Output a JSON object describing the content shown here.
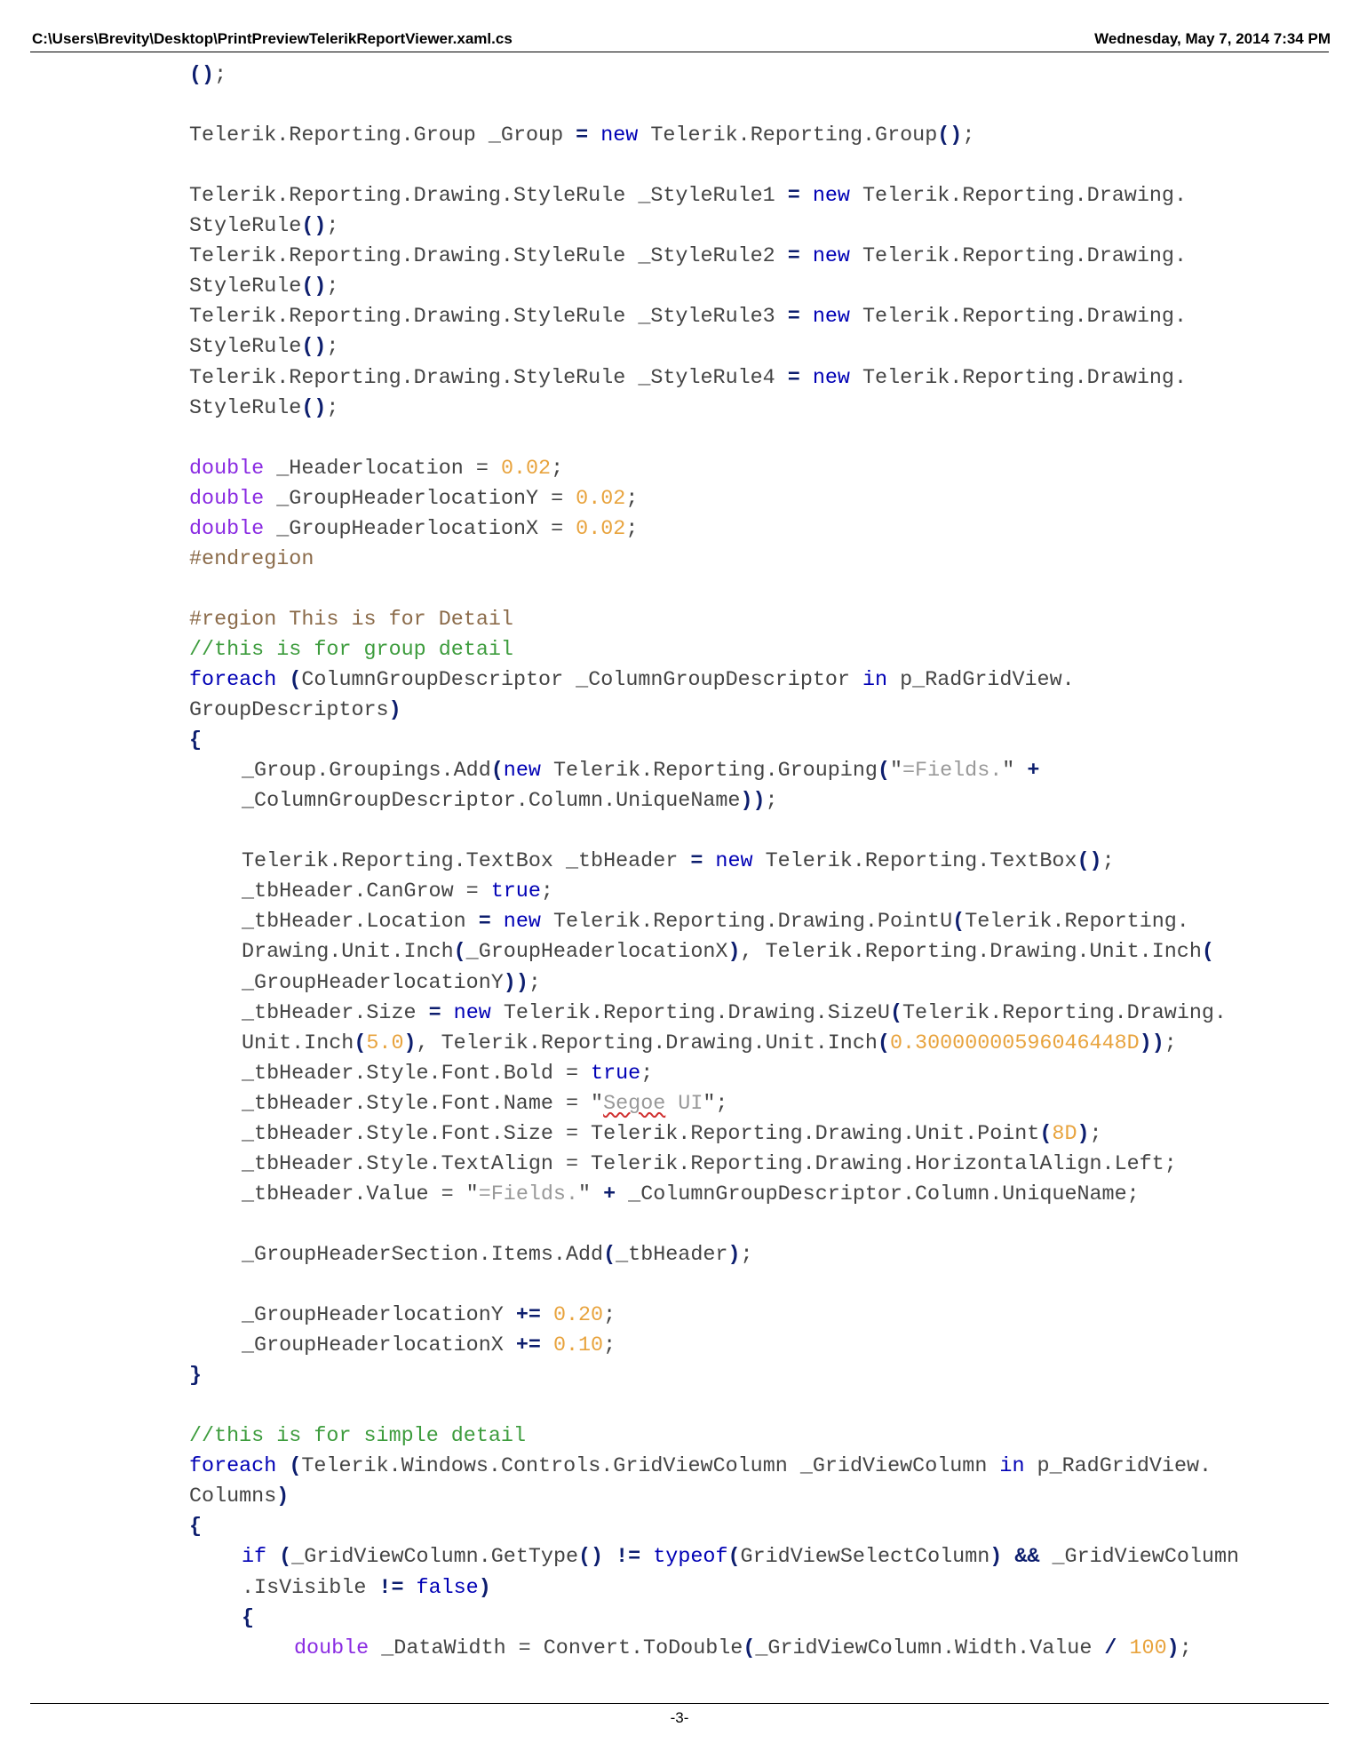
{
  "header": {
    "file_path": "C:\\Users\\Brevity\\Desktop\\PrintPreviewTelerikReportViewer.xaml.cs",
    "date_time": "Wednesday, May 7, 2014 7:34 PM"
  },
  "footer": {
    "page_label": "-3-"
  },
  "code_lines": [
    {
      "indent": 0,
      "tokens": [
        [
          "o",
          "()"
        ],
        [
          "p",
          ";"
        ]
      ]
    },
    null,
    {
      "indent": 0,
      "tokens": [
        [
          "p",
          "Telerik.Reporting.Group _Group "
        ],
        [
          "o",
          "="
        ],
        [
          "p",
          " "
        ],
        [
          "k",
          "new"
        ],
        [
          "p",
          " Telerik.Reporting.Group"
        ],
        [
          "o",
          "()"
        ],
        [
          "p",
          ";"
        ]
      ]
    },
    null,
    {
      "indent": 0,
      "tokens": [
        [
          "p",
          "Telerik.Reporting.Drawing.StyleRule _StyleRule1 "
        ],
        [
          "o",
          "="
        ],
        [
          "p",
          " "
        ],
        [
          "k",
          "new"
        ],
        [
          "p",
          " Telerik.Reporting.Drawing."
        ]
      ]
    },
    {
      "indent": 0,
      "tokens": [
        [
          "p",
          "StyleRule"
        ],
        [
          "o",
          "()"
        ],
        [
          "p",
          ";"
        ]
      ]
    },
    {
      "indent": 0,
      "tokens": [
        [
          "p",
          "Telerik.Reporting.Drawing.StyleRule _StyleRule2 "
        ],
        [
          "o",
          "="
        ],
        [
          "p",
          " "
        ],
        [
          "k",
          "new"
        ],
        [
          "p",
          " Telerik.Reporting.Drawing."
        ]
      ]
    },
    {
      "indent": 0,
      "tokens": [
        [
          "p",
          "StyleRule"
        ],
        [
          "o",
          "()"
        ],
        [
          "p",
          ";"
        ]
      ]
    },
    {
      "indent": 0,
      "tokens": [
        [
          "p",
          "Telerik.Reporting.Drawing.StyleRule _StyleRule3 "
        ],
        [
          "o",
          "="
        ],
        [
          "p",
          " "
        ],
        [
          "k",
          "new"
        ],
        [
          "p",
          " Telerik.Reporting.Drawing."
        ]
      ]
    },
    {
      "indent": 0,
      "tokens": [
        [
          "p",
          "StyleRule"
        ],
        [
          "o",
          "()"
        ],
        [
          "p",
          ";"
        ]
      ]
    },
    {
      "indent": 0,
      "tokens": [
        [
          "p",
          "Telerik.Reporting.Drawing.StyleRule _StyleRule4 "
        ],
        [
          "o",
          "="
        ],
        [
          "p",
          " "
        ],
        [
          "k",
          "new"
        ],
        [
          "p",
          " Telerik.Reporting.Drawing."
        ]
      ]
    },
    {
      "indent": 0,
      "tokens": [
        [
          "p",
          "StyleRule"
        ],
        [
          "o",
          "()"
        ],
        [
          "p",
          ";"
        ]
      ]
    },
    null,
    {
      "indent": 0,
      "tokens": [
        [
          "t",
          "double"
        ],
        [
          "p",
          " _Headerlocation = "
        ],
        [
          "n",
          "0.02"
        ],
        [
          "p",
          ";"
        ]
      ]
    },
    {
      "indent": 0,
      "tokens": [
        [
          "t",
          "double"
        ],
        [
          "p",
          " _GroupHeaderlocationY = "
        ],
        [
          "n",
          "0.02"
        ],
        [
          "p",
          ";"
        ]
      ]
    },
    {
      "indent": 0,
      "tokens": [
        [
          "t",
          "double"
        ],
        [
          "p",
          " _GroupHeaderlocationX = "
        ],
        [
          "n",
          "0.02"
        ],
        [
          "p",
          ";"
        ]
      ]
    },
    {
      "indent": 0,
      "tokens": [
        [
          "d",
          "#endregion"
        ]
      ]
    },
    null,
    {
      "indent": 0,
      "tokens": [
        [
          "d",
          "#region This is for Detail"
        ]
      ]
    },
    {
      "indent": 0,
      "tokens": [
        [
          "c",
          "//this is for group detail"
        ]
      ]
    },
    {
      "indent": 0,
      "tokens": [
        [
          "k",
          "foreach"
        ],
        [
          "p",
          " "
        ],
        [
          "o",
          "("
        ],
        [
          "p",
          "ColumnGroupDescriptor _ColumnGroupDescriptor "
        ],
        [
          "k",
          "in"
        ],
        [
          "p",
          " p_RadGridView."
        ]
      ]
    },
    {
      "indent": 0,
      "tokens": [
        [
          "p",
          "GroupDescriptors"
        ],
        [
          "o",
          ")"
        ]
      ]
    },
    {
      "indent": 0,
      "tokens": [
        [
          "o",
          "{"
        ]
      ]
    },
    {
      "indent": 1,
      "tokens": [
        [
          "p",
          "_Group.Groupings.Add"
        ],
        [
          "o",
          "("
        ],
        [
          "k",
          "new"
        ],
        [
          "p",
          " Telerik.Reporting.Grouping"
        ],
        [
          "o",
          "("
        ],
        [
          "p",
          "\""
        ],
        [
          "s",
          "=Fields."
        ],
        [
          "p",
          "\" "
        ],
        [
          "o",
          "+"
        ]
      ]
    },
    {
      "indent": 1,
      "tokens": [
        [
          "p",
          "_ColumnGroupDescriptor.Column.UniqueName"
        ],
        [
          "o",
          "))"
        ],
        [
          "p",
          ";"
        ]
      ]
    },
    null,
    {
      "indent": 1,
      "tokens": [
        [
          "p",
          "Telerik.Reporting.TextBox _tbHeader "
        ],
        [
          "o",
          "="
        ],
        [
          "p",
          " "
        ],
        [
          "k",
          "new"
        ],
        [
          "p",
          " Telerik.Reporting.TextBox"
        ],
        [
          "o",
          "()"
        ],
        [
          "p",
          ";"
        ]
      ]
    },
    {
      "indent": 1,
      "tokens": [
        [
          "p",
          "_tbHeader.CanGrow = "
        ],
        [
          "k",
          "true"
        ],
        [
          "p",
          ";"
        ]
      ]
    },
    {
      "indent": 1,
      "tokens": [
        [
          "p",
          "_tbHeader.Location "
        ],
        [
          "o",
          "="
        ],
        [
          "p",
          " "
        ],
        [
          "k",
          "new"
        ],
        [
          "p",
          " Telerik.Reporting.Drawing.PointU"
        ],
        [
          "o",
          "("
        ],
        [
          "p",
          "Telerik.Reporting."
        ]
      ]
    },
    {
      "indent": 1,
      "tokens": [
        [
          "p",
          "Drawing.Unit.Inch"
        ],
        [
          "o",
          "("
        ],
        [
          "p",
          "_GroupHeaderlocationX"
        ],
        [
          "o",
          ")"
        ],
        [
          "p",
          ", Telerik.Reporting.Drawing.Unit.Inch"
        ],
        [
          "o",
          "("
        ]
      ]
    },
    {
      "indent": 1,
      "tokens": [
        [
          "p",
          "_GroupHeaderlocationY"
        ],
        [
          "o",
          "))"
        ],
        [
          "p",
          ";"
        ]
      ]
    },
    {
      "indent": 1,
      "tokens": [
        [
          "p",
          "_tbHeader.Size "
        ],
        [
          "o",
          "="
        ],
        [
          "p",
          " "
        ],
        [
          "k",
          "new"
        ],
        [
          "p",
          " Telerik.Reporting.Drawing.SizeU"
        ],
        [
          "o",
          "("
        ],
        [
          "p",
          "Telerik.Reporting.Drawing."
        ]
      ]
    },
    {
      "indent": 1,
      "tokens": [
        [
          "p",
          "Unit.Inch"
        ],
        [
          "o",
          "("
        ],
        [
          "n",
          "5.0"
        ],
        [
          "o",
          ")"
        ],
        [
          "p",
          ", Telerik.Reporting.Drawing.Unit.Inch"
        ],
        [
          "o",
          "("
        ],
        [
          "n",
          "0.30000000596046448D"
        ],
        [
          "o",
          "))"
        ],
        [
          "p",
          ";"
        ]
      ]
    },
    {
      "indent": 1,
      "tokens": [
        [
          "p",
          "_tbHeader.Style.Font.Bold = "
        ],
        [
          "k",
          "true"
        ],
        [
          "p",
          ";"
        ]
      ]
    },
    {
      "indent": 1,
      "tokens": [
        [
          "p",
          "_tbHeader.Style.Font.Name = \""
        ],
        [
          "q",
          "Segoe"
        ],
        [
          "s",
          " UI"
        ],
        [
          "p",
          "\";"
        ]
      ]
    },
    {
      "indent": 1,
      "tokens": [
        [
          "p",
          "_tbHeader.Style.Font.Size = Telerik.Reporting.Drawing.Unit.Point"
        ],
        [
          "o",
          "("
        ],
        [
          "n",
          "8D"
        ],
        [
          "o",
          ")"
        ],
        [
          "p",
          ";"
        ]
      ]
    },
    {
      "indent": 1,
      "tokens": [
        [
          "p",
          "_tbHeader.Style.TextAlign = Telerik.Reporting.Drawing.HorizontalAlign.Left;"
        ]
      ]
    },
    {
      "indent": 1,
      "tokens": [
        [
          "p",
          "_tbHeader.Value = \""
        ],
        [
          "s",
          "=Fields."
        ],
        [
          "p",
          "\" "
        ],
        [
          "o",
          "+"
        ],
        [
          "p",
          " _ColumnGroupDescriptor.Column.UniqueName;"
        ]
      ]
    },
    null,
    {
      "indent": 1,
      "tokens": [
        [
          "p",
          "_GroupHeaderSection.Items.Add"
        ],
        [
          "o",
          "("
        ],
        [
          "p",
          "_tbHeader"
        ],
        [
          "o",
          ")"
        ],
        [
          "p",
          ";"
        ]
      ]
    },
    null,
    {
      "indent": 1,
      "tokens": [
        [
          "p",
          "_GroupHeaderlocationY "
        ],
        [
          "o",
          "+="
        ],
        [
          "p",
          " "
        ],
        [
          "n",
          "0.20"
        ],
        [
          "p",
          ";"
        ]
      ]
    },
    {
      "indent": 1,
      "tokens": [
        [
          "p",
          "_GroupHeaderlocationX "
        ],
        [
          "o",
          "+="
        ],
        [
          "p",
          " "
        ],
        [
          "n",
          "0.10"
        ],
        [
          "p",
          ";"
        ]
      ]
    },
    {
      "indent": 0,
      "tokens": [
        [
          "o",
          "}"
        ]
      ]
    },
    null,
    {
      "indent": 0,
      "tokens": [
        [
          "c",
          "//this is for simple detail"
        ]
      ]
    },
    {
      "indent": 0,
      "tokens": [
        [
          "k",
          "foreach"
        ],
        [
          "p",
          " "
        ],
        [
          "o",
          "("
        ],
        [
          "p",
          "Telerik.Windows.Controls.GridViewColumn _GridViewColumn "
        ],
        [
          "k",
          "in"
        ],
        [
          "p",
          " p_RadGridView."
        ]
      ]
    },
    {
      "indent": 0,
      "tokens": [
        [
          "p",
          "Columns"
        ],
        [
          "o",
          ")"
        ]
      ]
    },
    {
      "indent": 0,
      "tokens": [
        [
          "o",
          "{"
        ]
      ]
    },
    {
      "indent": 1,
      "tokens": [
        [
          "k",
          "if"
        ],
        [
          "p",
          " "
        ],
        [
          "o",
          "("
        ],
        [
          "p",
          "_GridViewColumn.GetType"
        ],
        [
          "o",
          "()"
        ],
        [
          "p",
          " "
        ],
        [
          "o",
          "!="
        ],
        [
          "p",
          " "
        ],
        [
          "k",
          "typeof"
        ],
        [
          "o",
          "("
        ],
        [
          "p",
          "GridViewSelectColumn"
        ],
        [
          "o",
          ")"
        ],
        [
          "p",
          " "
        ],
        [
          "o",
          "&&"
        ],
        [
          "p",
          " _GridViewColumn"
        ]
      ]
    },
    {
      "indent": 1,
      "tokens": [
        [
          "p",
          ".IsVisible "
        ],
        [
          "o",
          "!="
        ],
        [
          "p",
          " "
        ],
        [
          "k",
          "false"
        ],
        [
          "o",
          ")"
        ]
      ]
    },
    {
      "indent": 1,
      "tokens": [
        [
          "o",
          "{"
        ]
      ]
    },
    {
      "indent": 2,
      "tokens": [
        [
          "t",
          "double"
        ],
        [
          "p",
          " _DataWidth = Convert.ToDouble"
        ],
        [
          "o",
          "("
        ],
        [
          "p",
          "_GridViewColumn.Width.Value "
        ],
        [
          "o",
          "/"
        ],
        [
          "p",
          " "
        ],
        [
          "n",
          "100"
        ],
        [
          "o",
          ")"
        ],
        [
          "p",
          ";"
        ]
      ]
    }
  ]
}
